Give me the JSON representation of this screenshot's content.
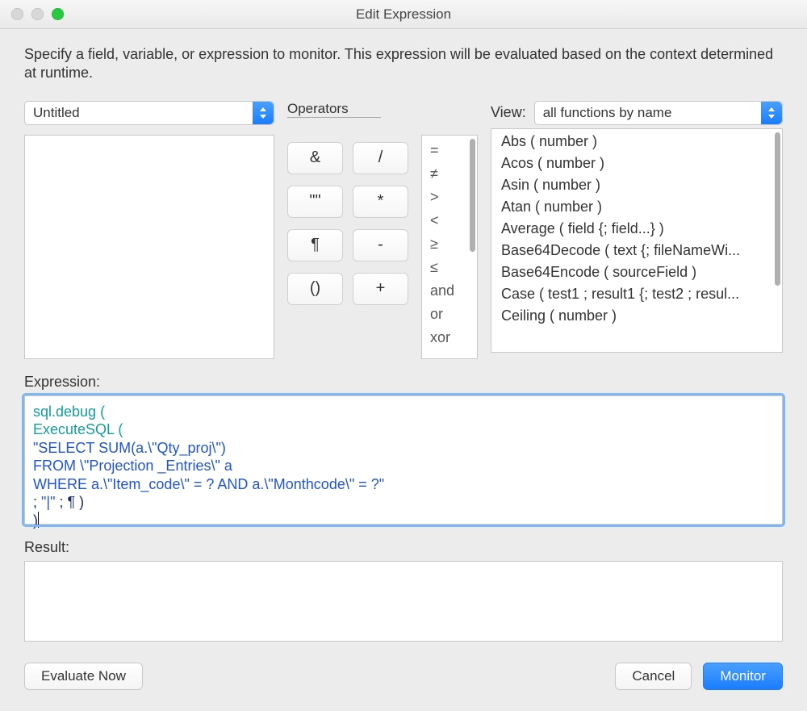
{
  "window": {
    "title": "Edit Expression"
  },
  "intro": "Specify a field, variable, or expression to monitor. This expression will be evaluated based on the context determined at runtime.",
  "source_select": "Untitled",
  "operators_label": "Operators",
  "operator_buttons": [
    "&",
    "/",
    "\"\"",
    "*",
    "¶",
    "-",
    "()",
    "+"
  ],
  "comparators": [
    "=",
    "≠",
    ">",
    "<",
    "≥",
    "≤",
    "and",
    "or",
    "xor"
  ],
  "view_label": "View:",
  "view_select": "all functions by name",
  "functions": [
    "Abs ( number )",
    "Acos ( number )",
    "Asin ( number )",
    "Atan ( number )",
    "Average ( field {; field...} )",
    "Base64Decode ( text {; fileNameWi...",
    "Base64Encode ( sourceField )",
    "Case ( test1 ; result1 {; test2 ; resul...",
    "Ceiling ( number )"
  ],
  "expression_label": "Expression:",
  "expression_lines": [
    {
      "cls": "teal",
      "text": "sql.debug ("
    },
    {
      "cls": "teal",
      "text": "ExecuteSQL ("
    },
    {
      "cls": "blue",
      "text": "\"SELECT SUM(a.\\\"Qty_proj\\\")"
    },
    {
      "cls": "blue",
      "text": "FROM \\\"Projection _Entries\\\" a"
    },
    {
      "cls": "blue",
      "text": "WHERE a.\\\"Item_code\\\" = ? AND a.\\\"Monthcode\\\" = ?\""
    },
    {
      "cls": "mixed",
      "prefix": "; ",
      "mid": "\"|\"",
      "suffix": " ; ¶ )"
    },
    {
      "cls": "navy",
      "text": ")"
    }
  ],
  "result_label": "Result:",
  "buttons": {
    "evaluate": "Evaluate Now",
    "cancel": "Cancel",
    "monitor": "Monitor"
  }
}
